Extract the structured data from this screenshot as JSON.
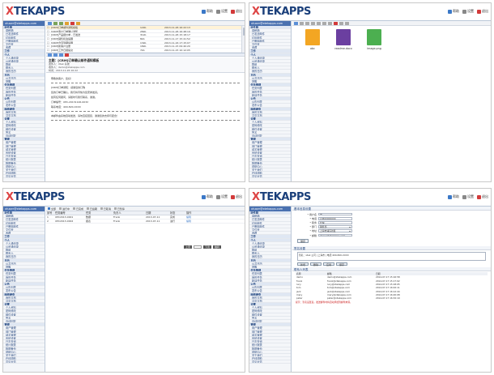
{
  "brand": {
    "x_mark": "X",
    "name": "TEKAPPS"
  },
  "header_links": [
    {
      "label": "帮助",
      "icon": "help-icon",
      "color": "#3b78c7"
    },
    {
      "label": "设置",
      "icon": "settings-icon",
      "color": "#888888"
    },
    {
      "label": "退出",
      "icon": "logout-icon",
      "color": "#d23a3a"
    }
  ],
  "account": "xtuser@xtekapps.com",
  "sidebar_rows": [
    {
      "t": "收件箱",
      "hd": true
    },
    {
      "t": "草稿箱"
    },
    {
      "t": "已发送邮件"
    },
    {
      "t": "垃圾邮件"
    },
    {
      "t": "已删除邮件"
    },
    {
      "t": "文件夹"
    },
    {
      "t": "收藏"
    },
    {
      "t": "工作",
      "hd": true
    },
    {
      "t": "个人",
      "hd": true
    },
    {
      "t": "个人通讯录"
    },
    {
      "t": "公司通讯录"
    },
    {
      "t": "群组"
    },
    {
      "t": "联系人"
    },
    {
      "t": "我的日历"
    },
    {
      "t": "日历",
      "hd": true
    },
    {
      "t": "公共日历"
    },
    {
      "t": "提醒"
    },
    {
      "t": "任务管理",
      "hd": true
    },
    {
      "t": "任务列表"
    },
    {
      "t": "我的任务"
    },
    {
      "t": "新建任务"
    },
    {
      "t": "公告",
      "hd": true
    },
    {
      "t": "公告列表"
    },
    {
      "t": "发布公告"
    },
    {
      "t": "网络硬盘",
      "hd": true
    },
    {
      "t": "我的文档"
    },
    {
      "t": "共享文档"
    },
    {
      "t": "设置",
      "hd": true
    },
    {
      "t": "个人资料"
    },
    {
      "t": "密码修改"
    },
    {
      "t": "邮件设置"
    },
    {
      "t": "签名"
    },
    {
      "t": "自动回复"
    },
    {
      "t": "管理",
      "hd": true
    },
    {
      "t": "用户管理"
    },
    {
      "t": "部门管理"
    },
    {
      "t": "域名管理"
    },
    {
      "t": "系统设置"
    },
    {
      "t": "日志查询"
    },
    {
      "t": "统计报表"
    },
    {
      "t": "数据备份"
    },
    {
      "t": "帮助中心"
    },
    {
      "t": "关于我们"
    },
    {
      "t": "在线帮助"
    },
    {
      "t": "意见反馈"
    }
  ],
  "inbox": {
    "rows": [
      {
        "from": "[CRM]订单邮件通知模板",
        "size": "12kb",
        "date": "2013-11-26 16:22:13"
      },
      {
        "from": "[CRM]客户订单确认通知",
        "size": "28kb",
        "date": "2013-11-26 16:48:19"
      },
      {
        "from": "[CRM]产品报价单 - 已发送",
        "size": "31kb",
        "date": "2013-11-26 15:18:17"
      },
      {
        "from": "[CRM]销售机会提醒",
        "size": "8kb",
        "date": "2013-11-17 15:41:52"
      },
      {
        "from": "[CRM]合同到期提醒",
        "size": "13kb",
        "date": "2013-11-16 17:15:07"
      },
      {
        "from": "[CRM]新客户注册",
        "size": "18kb",
        "date": "2013-11-15 09:40:20"
      },
      {
        "from": "[CRM]工作日报提交",
        "size": "7kb",
        "date": "2013-11-15 10:12:05"
      }
    ],
    "preview_subject": "主题：[CRM]订单确认邮件通知模板",
    "preview_from": "发件人：Xtek 系统",
    "preview_to": "收件人：demo@xtekapps.com",
    "preview_date": "时间：2013-11-26 16:22",
    "body_lines": [
      "尊敬的客户，您好！",
      "[CRM]订单通知：感谢您的订购",
      "您的订单已确认，我们将尽快为您安排发货。",
      "如有任何疑问，请随时与我们联系，谢谢。",
      "订单编号：XPC-20131126-0032",
      "联系电话：400-820-XXXX",
      "本邮件由系统自动发送，请勿直接回复，谢谢您的支持与配合！"
    ]
  },
  "files": [
    {
      "name": "abc",
      "color": "#f3a623"
    },
    {
      "name": "readme.docx",
      "color": "#6b3fa0"
    },
    {
      "name": "image.png",
      "color": "#4caf50"
    }
  ],
  "tasks": {
    "tabs": [
      "全部",
      "进行中",
      "已完成",
      "已逾期",
      "已取消",
      "已暂停"
    ],
    "headers": [
      "序号",
      "任务编号",
      "任务",
      "负责人",
      "日期",
      "状态",
      "操作"
    ],
    "rows": [
      [
        "1",
        "XPC2013-0001",
        "数据",
        "Frank",
        "2013-07-11",
        "完成",
        "编辑"
      ],
      [
        "2",
        "XPC2013-0002",
        "报表",
        "Frank",
        "2013-07-11",
        "进行",
        "编辑"
      ]
    ],
    "pager": {
      "prev": "上页",
      "next": "下页",
      "go": "跳转"
    }
  },
  "settings": {
    "title": "基本信息设置",
    "fields": [
      {
        "label": "* 用户名",
        "value": "张三"
      },
      {
        "label": "* 电话",
        "value": "13800000000"
      },
      {
        "label": "* 职务",
        "value": "经理"
      },
      {
        "label": "* 部门",
        "value": "销售部",
        "select": true
      },
      {
        "label": "* 地址",
        "value": "上海市浦东新区",
        "select": true
      },
      {
        "label": "* 邮箱",
        "value": "xtuser@xtekapps.com"
      }
    ],
    "save": "保存",
    "sig_title": "签名设置",
    "sig_text": "签名：xtek 公司 | 上海市 | 电话 400-820-XXXX",
    "sig_btns": [
      "新增",
      "删除",
      "应用",
      "保存"
    ],
    "list_title": "联系人列表",
    "list_headers": [
      "名称",
      "邮箱",
      "日期"
    ],
    "list_rows": [
      [
        "demo",
        "demo@xtekapps.com",
        "2014-07-17 15:16:58"
      ],
      [
        "frank",
        "frank@xtekapps.com",
        "2014-07-17 15:17:02"
      ],
      [
        "lucy",
        "lucy@xtekapps.com",
        "2014-07-17 15:18:05"
      ],
      [
        "tom",
        "tom@xtekapps.com",
        "2014-07-17 16:02:11"
      ],
      [
        "jack",
        "jack@xtekapps.com",
        "2014-07-17 16:12:44"
      ],
      [
        "mary",
        "mary@xtekapps.com",
        "2014-07-17 16:20:08"
      ],
      [
        "peter",
        "peter@xtekapps.com",
        "2014-07-17 16:32:19"
      ]
    ],
    "note_red": "提示：签名设置后，发送邮件时将自动添加到邮件末尾。"
  }
}
